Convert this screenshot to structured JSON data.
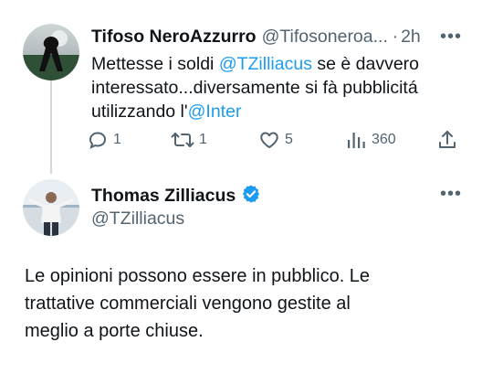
{
  "reply_tweet": {
    "author_name": "Tifoso NeroAzzurro",
    "author_handle": "@Tifosoneroa...",
    "separator": "·",
    "time": "2h",
    "more_label": "•••",
    "text_lines": [
      {
        "before": "Mettesse i soldi ",
        "mention": "@TZilliacus",
        "after": " se è davvero"
      },
      {
        "before": "interessato...diversamente si fà pubblicitá",
        "mention": "",
        "after": ""
      },
      {
        "before": "utilizzando l'",
        "mention": "@Inter",
        "after": ""
      }
    ],
    "stats": {
      "replies": "1",
      "reposts": "1",
      "likes": "5",
      "views": "360"
    }
  },
  "main_tweet": {
    "author_name": "Thomas Zilliacus",
    "author_handle": "@TZilliacus",
    "more_label": "•••",
    "text_lines": [
      "Le opinioni possono essere in pubblico. Le",
      "trattative commerciali vengono gestite al",
      "meglio a porte chiuse."
    ]
  },
  "icons": {
    "reply": "comment-bubble-icon",
    "repost": "repost-arrows-icon",
    "like": "heart-icon",
    "views": "bar-chart-icon",
    "share": "share-upload-icon",
    "verified": "verified-badge-icon"
  },
  "colors": {
    "text": "#0f1419",
    "secondary": "#536471",
    "link": "#1d9bf0",
    "verified": "#1d9bf0",
    "divider": "#cfd9de"
  }
}
